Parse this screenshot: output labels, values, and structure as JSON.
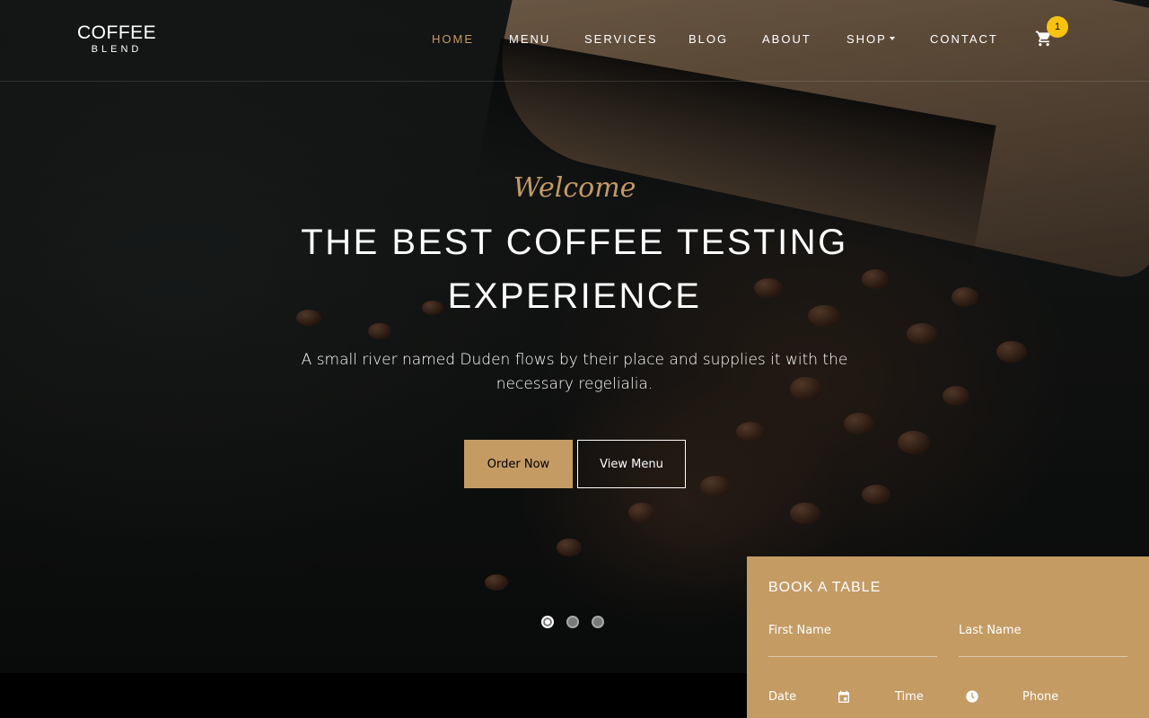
{
  "brand": {
    "line1": "COFFEE",
    "line2": "BLEND"
  },
  "nav": {
    "items": [
      {
        "label": "HOME",
        "active": true
      },
      {
        "label": "MENU",
        "active": false
      },
      {
        "label": "SERVICES",
        "active": false
      },
      {
        "label": "BLOG",
        "active": false
      },
      {
        "label": "ABOUT",
        "active": false
      },
      {
        "label": "SHOP",
        "active": false,
        "dropdown": true
      },
      {
        "label": "CONTACT",
        "active": false
      }
    ],
    "cart_count": "1"
  },
  "hero": {
    "welcome": "Welcome",
    "headline_line1": "THE BEST COFFEE TESTING",
    "headline_line2": "EXPERIENCE",
    "subtext_line1": "A small river named Duden flows by their place and supplies it with the",
    "subtext_line2": "necessary regelialia.",
    "order_label": "Order Now",
    "view_label": "View Menu",
    "slides": 3,
    "active_slide": 1
  },
  "booking": {
    "title": "BOOK A TABLE",
    "first_name": "First Name",
    "last_name": "Last Name",
    "date": "Date",
    "time": "Time",
    "phone": "Phone"
  },
  "colors": {
    "accent": "#c49b63",
    "badge": "#f9c20e"
  }
}
